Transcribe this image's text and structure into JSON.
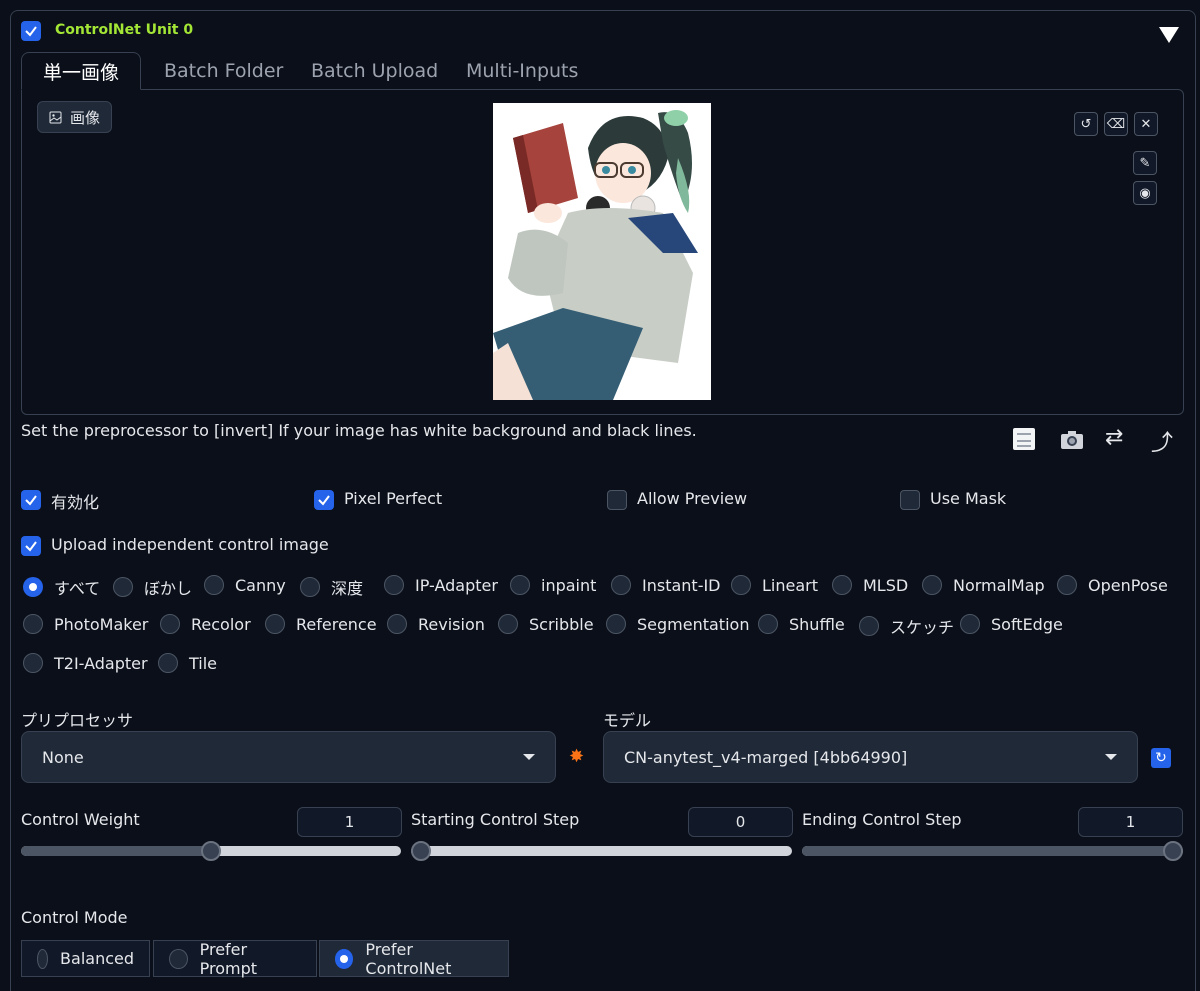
{
  "unit": {
    "title": "ControlNet Unit 0",
    "enabled": true
  },
  "tabs": [
    {
      "label": "単一画像",
      "active": true
    },
    {
      "label": "Batch Folder",
      "active": false
    },
    {
      "label": "Batch Upload",
      "active": false
    },
    {
      "label": "Multi-Inputs",
      "active": false
    }
  ],
  "image_panel": {
    "badge_label": "画像",
    "toolbar_icons": [
      "undo-icon",
      "eraser-icon",
      "close-icon"
    ],
    "side_icons": [
      "brush-icon",
      "palette-icon"
    ]
  },
  "hint_text": "Set the preprocessor to [invert] If your image has white background and black lines.",
  "action_icons": [
    "memo-icon",
    "camera-icon",
    "swap-icon",
    "send-icon"
  ],
  "options": [
    {
      "label": "有効化",
      "checked": true
    },
    {
      "label": "Pixel Perfect",
      "checked": true
    },
    {
      "label": "Allow Preview",
      "checked": false
    },
    {
      "label": "Use Mask",
      "checked": false
    }
  ],
  "upload_independent": {
    "label": "Upload independent control image",
    "checked": true
  },
  "control_types": [
    "すべて",
    "ぼかし",
    "Canny",
    "深度",
    "IP-Adapter",
    "inpaint",
    "Instant-ID",
    "Lineart",
    "MLSD",
    "NormalMap",
    "OpenPose",
    "PhotoMaker",
    "Recolor",
    "Reference",
    "Revision",
    "Scribble",
    "Segmentation",
    "Shuffle",
    "スケッチ",
    "SoftEdge",
    "T2I-Adapter",
    "Tile"
  ],
  "control_type_selected": "すべて",
  "preprocessor": {
    "label": "プリプロセッサ",
    "value": "None",
    "run_icon": "explosion-icon"
  },
  "model": {
    "label": "モデル",
    "value": "CN-anytest_v4-marged [4bb64990]",
    "refresh_icon": "refresh-icon"
  },
  "sliders": [
    {
      "label": "Control Weight",
      "value": "1",
      "fraction": 0.5
    },
    {
      "label": "Starting Control Step",
      "value": "0",
      "fraction": 0.0
    },
    {
      "label": "Ending Control Step",
      "value": "1",
      "fraction": 1.0
    }
  ],
  "control_mode": {
    "label": "Control Mode",
    "options": [
      "Balanced",
      "Prefer Prompt",
      "Prefer ControlNet"
    ],
    "selected": "Prefer ControlNet"
  },
  "colors": {
    "accent": "#2563eb",
    "title_green": "#a3e635",
    "bg": "#0b0f19"
  }
}
